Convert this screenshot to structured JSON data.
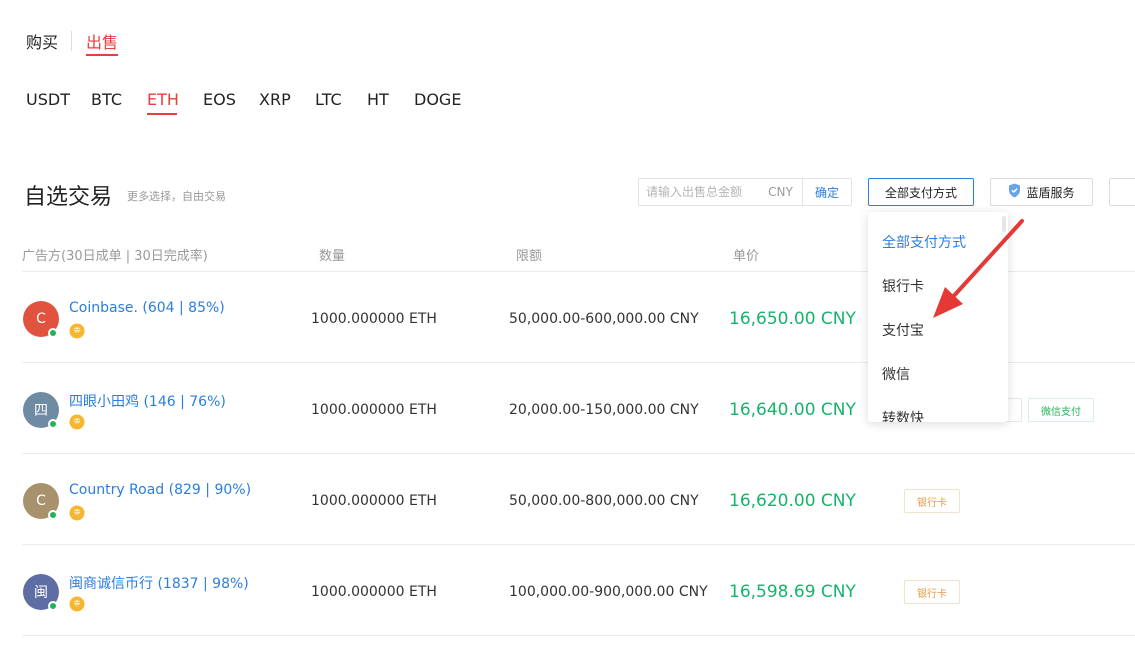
{
  "trade_switch": {
    "buy": "购买",
    "sell": "出售",
    "active": "sell"
  },
  "coins": [
    "USDT",
    "BTC",
    "ETH",
    "EOS",
    "XRP",
    "LTC",
    "HT",
    "DOGE"
  ],
  "active_coin": "ETH",
  "section": {
    "title": "自选交易",
    "subtitle": "更多选择，自由交易"
  },
  "amount_filter": {
    "placeholder": "请输入出售总金额",
    "unit": "CNY",
    "confirm_label": "确定"
  },
  "payment_filter_label": "全部支付方式",
  "shield_service_label": "蓝盾服务",
  "table_headers": {
    "advertiser": "广告方(30日成单 | 30日完成率)",
    "quantity": "数量",
    "limit": "限额",
    "price": "单价"
  },
  "rows": [
    {
      "avatar_letter": "C",
      "avatar_color": "#e2533f",
      "merchant": "Coinbase. (604 | 85%)",
      "quantity": "1000.000000 ETH",
      "limit": "50,000.00-600,000.00 CNY",
      "price": "16,650.00 CNY",
      "payments": []
    },
    {
      "avatar_letter": "四",
      "avatar_color": "#6f8aa3",
      "merchant": "四眼小田鸡 (146 | 76%)",
      "quantity": "1000.000000 ETH",
      "limit": "20,000.00-150,000.00 CNY",
      "price": "16,640.00 CNY",
      "payments": [
        "微信支付"
      ]
    },
    {
      "avatar_letter": "C",
      "avatar_color": "#a8926d",
      "merchant": "Country Road (829 | 90%)",
      "quantity": "1000.000000 ETH",
      "limit": "50,000.00-800,000.00 CNY",
      "price": "16,620.00 CNY",
      "payments": [
        "银行卡"
      ]
    },
    {
      "avatar_letter": "闽",
      "avatar_color": "#5e6da3",
      "merchant": "闽商诚信币行 (1837 | 98%)",
      "quantity": "1000.000000 ETH",
      "limit": "100,000.00-900,000.00 CNY",
      "price": "16,598.69 CNY",
      "payments": [
        "银行卡"
      ]
    }
  ],
  "payment_dropdown": {
    "items": [
      "全部支付方式",
      "银行卡",
      "支付宝",
      "微信",
      "转数快"
    ],
    "selected": "全部支付方式"
  },
  "colors": {
    "accent_red": "#e5413c",
    "link_blue": "#2b7ee0",
    "price_green": "#16b36a",
    "bank_tag": "#e39a45",
    "wechat_tag": "#22b35a",
    "arrow": "#e53935"
  }
}
